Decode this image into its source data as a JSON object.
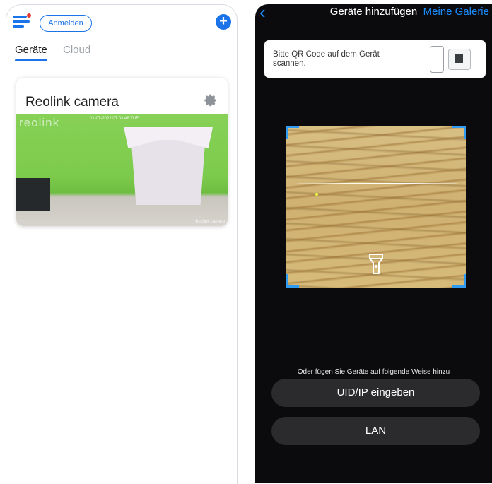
{
  "left_screen": {
    "login_label": "Anmelden",
    "tabs": [
      {
        "label": "Geräte",
        "active": true
      },
      {
        "label": "Cloud",
        "active": false
      }
    ],
    "camera_card": {
      "name": "Reolink camera",
      "watermark": "reolink",
      "osd_timestamp": "01-07-2022 07:03:48 TUE",
      "osd_name": "Reolink camera"
    },
    "accent_color": "#1a73e8"
  },
  "right_screen": {
    "title": "Geräte hinzufügen",
    "gallery_link": "Meine Galerie",
    "qr_hint": "Bitte QR Code auf dem Gerät scannen.",
    "alt_methods_text": "Oder fügen Sie Geräte auf folgende Weise hinzu",
    "buttons": [
      {
        "label": "UID/IP eingeben"
      },
      {
        "label": "LAN"
      }
    ],
    "accent_color": "#1a8cff"
  },
  "icons": [
    "menu-icon",
    "add-device-icon",
    "settings-gear-icon",
    "back-chevron-icon",
    "flashlight-icon",
    "phone-illustration-icon",
    "camera-illustration-icon"
  ]
}
